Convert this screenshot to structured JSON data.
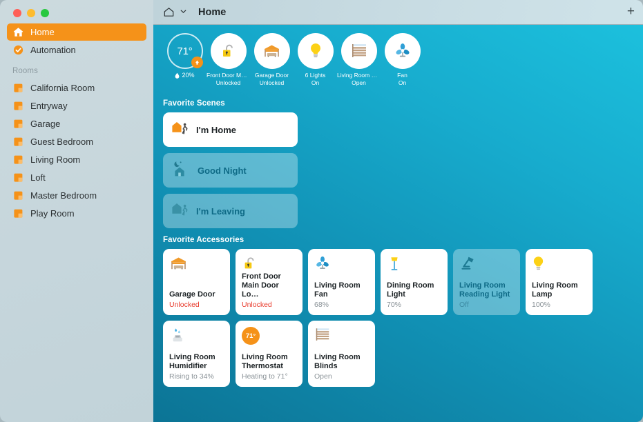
{
  "window": {
    "traffic_lights": [
      "close",
      "minimize",
      "zoom"
    ]
  },
  "toolbar": {
    "home_icon": "house-outline-icon",
    "chevron": "chevron-down-icon",
    "title": "Home",
    "add_label": "+"
  },
  "sidebar": {
    "items": [
      {
        "label": "Home",
        "icon": "house-icon",
        "selected": true
      },
      {
        "label": "Automation",
        "icon": "automation-check-icon",
        "selected": false
      }
    ],
    "rooms_header": "Rooms",
    "rooms": [
      {
        "label": "California Room",
        "icon": "room-icon"
      },
      {
        "label": "Entryway",
        "icon": "room-icon"
      },
      {
        "label": "Garage",
        "icon": "room-icon"
      },
      {
        "label": "Guest Bedroom",
        "icon": "room-icon"
      },
      {
        "label": "Living Room",
        "icon": "room-icon"
      },
      {
        "label": "Loft",
        "icon": "room-icon"
      },
      {
        "label": "Master Bedroom",
        "icon": "room-icon"
      },
      {
        "label": "Play Room",
        "icon": "room-icon"
      }
    ]
  },
  "status_tiles": [
    {
      "type": "thermostat",
      "temperature": "71°",
      "humidity": "20%",
      "icon": "thermostat-ring-icon",
      "badge": "arrow-up-icon"
    },
    {
      "type": "lock",
      "name": "Front Door Mai…",
      "state": "Unlocked",
      "icon": "lock-open-icon"
    },
    {
      "type": "garage",
      "name": "Garage Door",
      "state": "Unlocked",
      "icon": "garage-door-icon"
    },
    {
      "type": "lights",
      "name": "6 Lights",
      "state": "On",
      "icon": "lightbulb-icon"
    },
    {
      "type": "blinds",
      "name": "Living Room Bl…",
      "state": "Open",
      "icon": "blinds-icon"
    },
    {
      "type": "fan",
      "name": "Fan",
      "state": "On",
      "icon": "fan-icon"
    }
  ],
  "scenes": {
    "title": "Favorite Scenes",
    "items": [
      {
        "label": "I'm Home",
        "icon": "house-walking-icon",
        "active": true
      },
      {
        "label": "Good Night",
        "icon": "moon-house-icon",
        "active": false
      },
      {
        "label": "I'm Leaving",
        "icon": "house-leaving-icon",
        "active": false
      }
    ]
  },
  "accessories": {
    "title": "Favorite Accessories",
    "items": [
      {
        "name": "Garage Door",
        "state": "Unlocked",
        "icon": "garage-door-icon",
        "active": true,
        "alert": true
      },
      {
        "name": "Front Door Main Door Lo…",
        "state": "Unlocked",
        "icon": "lock-open-icon",
        "active": true,
        "alert": true
      },
      {
        "name": "Living Room Fan",
        "state": "68%",
        "icon": "fan-icon",
        "active": true,
        "alert": false
      },
      {
        "name": "Dining Room Light",
        "state": "70%",
        "icon": "floor-lamp-icon",
        "active": true,
        "alert": false
      },
      {
        "name": "Living Room Reading Light",
        "state": "Off",
        "icon": "reading-lamp-icon",
        "active": false,
        "alert": false
      },
      {
        "name": "Living Room Lamp",
        "state": "100%",
        "icon": "lightbulb-icon",
        "active": true,
        "alert": false
      },
      {
        "name": "Living Room Humidifier",
        "state": "Rising to 34%",
        "icon": "humidifier-icon",
        "active": true,
        "alert": false
      },
      {
        "name": "Living Room Thermostat",
        "state": "Heating to 71°",
        "icon": "thermostat-badge-icon",
        "badge_text": "71°",
        "active": true,
        "alert": false
      },
      {
        "name": "Living Room Blinds",
        "state": "Open",
        "icon": "blinds-icon",
        "active": true,
        "alert": false
      }
    ]
  },
  "colors": {
    "accent_orange": "#f59219",
    "alert_red": "#e8392a",
    "bg_cyan": "#1cc0dd",
    "bg_teal": "#0c7495",
    "sidebar": "#c9d9de"
  }
}
